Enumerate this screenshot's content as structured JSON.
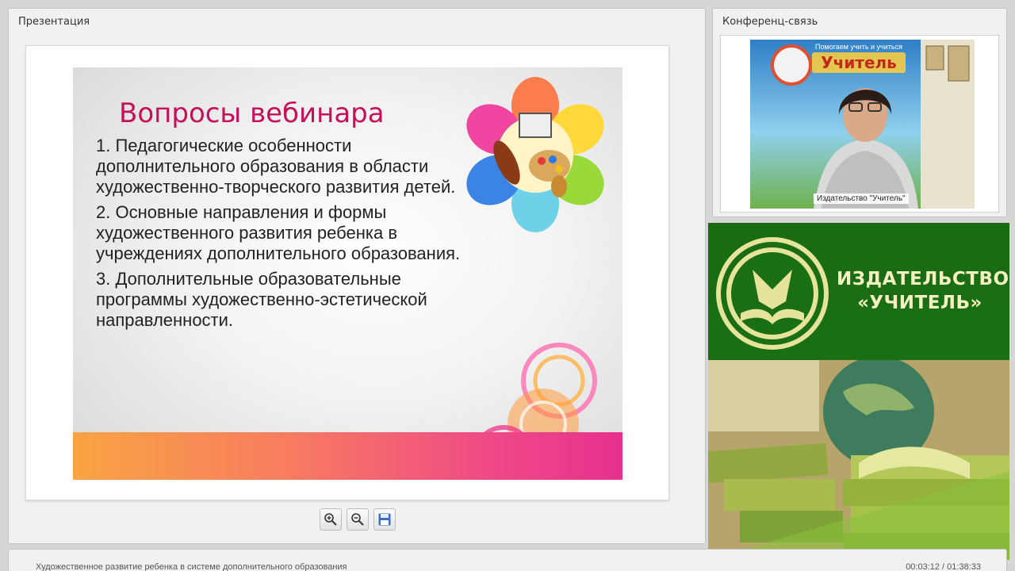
{
  "presentation_panel": {
    "title": "Презентация"
  },
  "conference_panel": {
    "title": "Конференц-связь"
  },
  "slide": {
    "title": "Вопросы вебинара",
    "items": [
      "1. Педагогические особенности дополнительного образования в области художественно-творческого развития детей.",
      "2. Основные направления и формы художественного развития ребенка в учреждениях дополнительного образования.",
      "3. Дополнительные образовательные программы художественно-эстетической направленности."
    ]
  },
  "toolbar": {
    "buttons": [
      {
        "name": "zoom-in",
        "icon": "zoom-in-icon"
      },
      {
        "name": "zoom-out",
        "icon": "zoom-out-icon"
      },
      {
        "name": "save",
        "icon": "save-icon"
      }
    ]
  },
  "video": {
    "label": "Издательство \"Учитель\"",
    "backdrop_heading": "Учитель",
    "backdrop_tagline": "Помогаем учить и учиться"
  },
  "ad": {
    "line1": "ИЗДАТЕЛЬСТВО",
    "line2": "«УЧИТЕЛЬ»"
  },
  "status": {
    "webinar_title": "Художественное развитие ребенка в системе дополнительного образования",
    "time": "00:03:12 / 01:38:33"
  },
  "colors": {
    "slide_title": "#c4115a",
    "ad_green": "#1a6f14",
    "ad_text": "#f4f0c2"
  }
}
